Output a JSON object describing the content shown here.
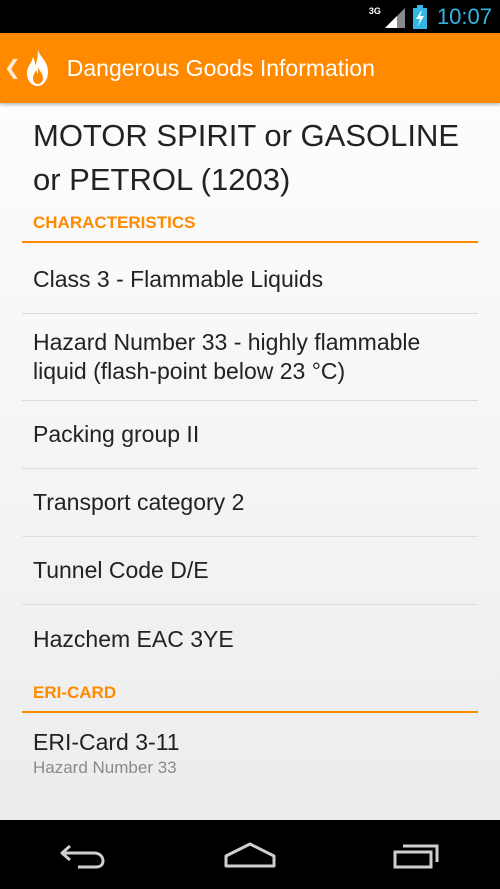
{
  "status_bar": {
    "network": "3G",
    "time": "10:07"
  },
  "action_bar": {
    "title": "Dangerous Goods Information",
    "up_icon": "chevron-left-icon",
    "app_icon": "flame-icon",
    "color": "#ff8a00"
  },
  "product": {
    "title": "MOTOR SPIRIT or GASOLINE or PETROL (1203)"
  },
  "sections": {
    "characteristics": {
      "header": "CHARACTERISTICS",
      "items": [
        {
          "label": "Class 3 - Flammable Liquids"
        },
        {
          "label": "Hazard Number 33 - highly flammable liquid (flash-point below 23 °C)"
        },
        {
          "label": "Packing group II"
        },
        {
          "label": "Transport category 2"
        },
        {
          "label": "Tunnel Code D/E"
        },
        {
          "label": "Hazchem EAC 3YE"
        }
      ]
    },
    "eri_card": {
      "header": "ERI-CARD",
      "items": [
        {
          "label": "ERI-Card 3-11",
          "sublabel": "Hazard Number 33"
        }
      ]
    }
  },
  "nav_bar": {
    "back_icon": "back-icon",
    "home_icon": "home-icon",
    "recents_icon": "recents-icon"
  },
  "colors": {
    "accent": "#ff8a00",
    "status_blue": "#33b5e5"
  }
}
